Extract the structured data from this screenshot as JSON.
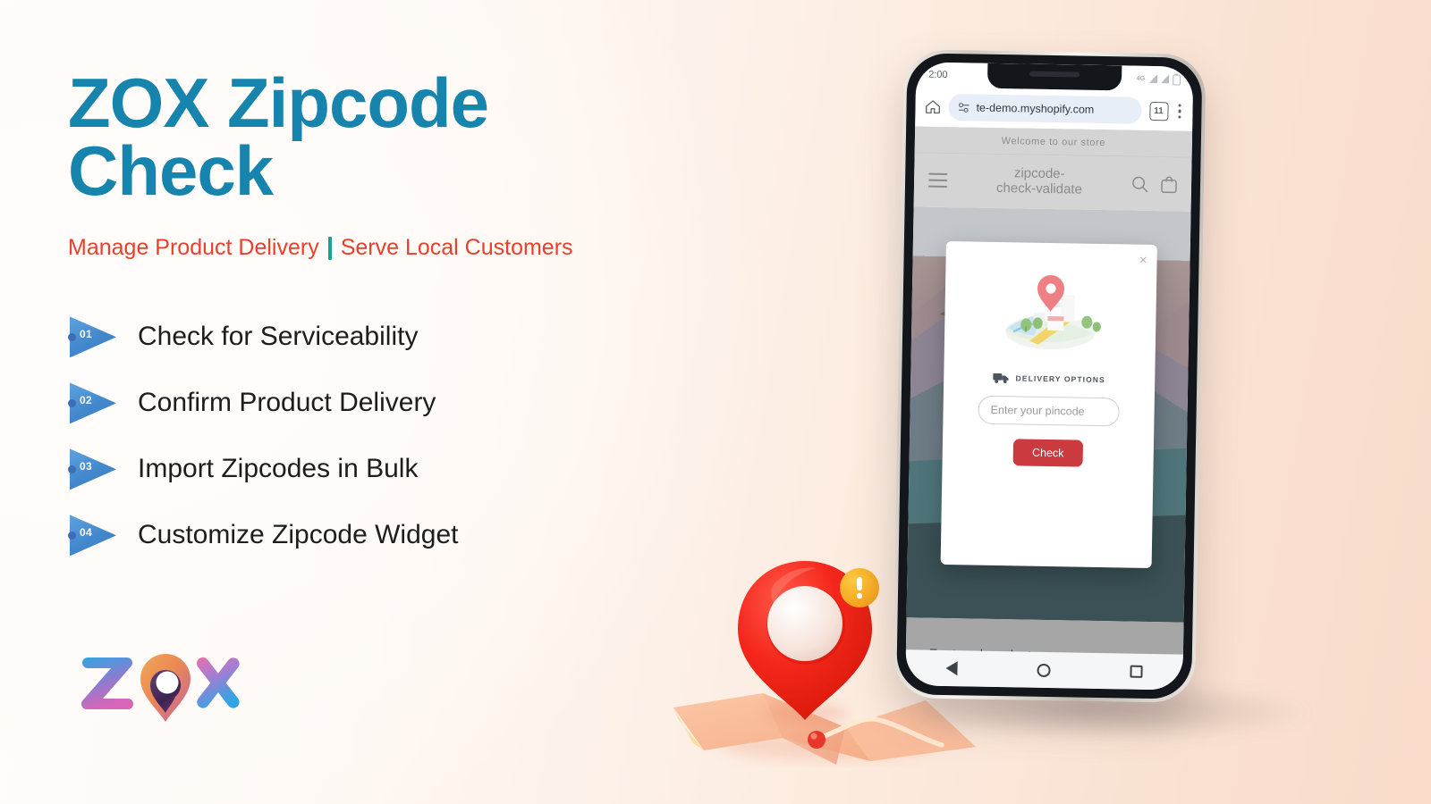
{
  "hero": {
    "title_line1": "ZOX Zipcode",
    "title_line2": "Check",
    "subtitle_left": "Manage Product Delivery",
    "subtitle_right": "Serve Local Customers",
    "title_color": "#1784AE",
    "subtitle_color": "#E8402A",
    "separator_color": "#19A396"
  },
  "features": [
    {
      "number": "01",
      "label": "Check for Serviceability"
    },
    {
      "number": "02",
      "label": "Confirm Product Delivery"
    },
    {
      "number": "03",
      "label": "Import Zipcodes in Bulk"
    },
    {
      "number": "04",
      "label": "Customize Zipcode Widget"
    }
  ],
  "logo": {
    "text": "ZOX"
  },
  "phone": {
    "status": {
      "time": "2:00",
      "network": "4G",
      "battery_icon": "battery-icon"
    },
    "browser": {
      "home_icon": "home-icon",
      "site_settings_icon": "site-settings-icon",
      "url": "te-demo.myshopify.com",
      "tab_count": "11",
      "menu_icon": "kebab-menu-icon"
    },
    "store": {
      "announcement": "Welcome to our store",
      "name": "zipcode-\ncheck-validate",
      "menu_icon": "hamburger-icon",
      "search_icon": "search-icon",
      "cart_icon": "shopping-bag-icon",
      "featured_heading": "Featured products"
    },
    "modal": {
      "close_label": "×",
      "illustration": "map-location-illustration",
      "truck_icon": "delivery-truck-icon",
      "delivery_label": "DELIVERY OPTIONS",
      "input_placeholder": "Enter your pincode",
      "input_value": "",
      "button_label": "Check",
      "button_color": "#CB3A3E"
    },
    "navbar": {
      "back": "back-triangle-icon",
      "home": "home-circle-icon",
      "recents": "recents-square-icon"
    }
  },
  "decor": {
    "pin": "3d-map-pin",
    "badge": "!",
    "map": "folded-paper-map"
  }
}
